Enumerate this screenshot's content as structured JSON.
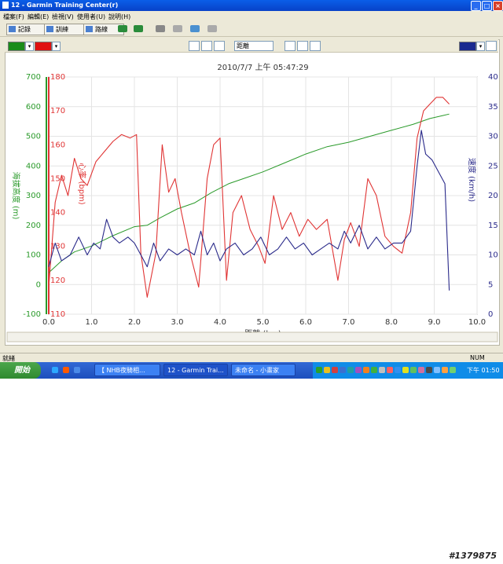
{
  "window": {
    "title": "12 - Garmin Training Center(r)"
  },
  "menu": {
    "items": [
      "檔案(F)",
      "編輯(E)",
      "檢視(V)",
      "使用者(U)",
      "說明(H)"
    ]
  },
  "tabs": [
    "記錄",
    "訓練",
    "路線"
  ],
  "controls": {
    "left_color": "#1a8c1a",
    "right_color": "#e01010",
    "xaxis_select": "距離",
    "right_swatch": "#1a2a90"
  },
  "chart_header": {
    "datetime": "2010/7/7 上午 05:47:29"
  },
  "status": {
    "left": "就緒",
    "right": "NUM"
  },
  "taskbar": {
    "start": "開始",
    "tasks": [
      "【 NHB夜騎相...",
      "12 - Garmin Trai...",
      "未命名 - 小畫家"
    ],
    "clock": "下午 01:50"
  },
  "watermark": "#1379875",
  "colors": {
    "elevation": "#2a9a2a",
    "heart": "#e03434",
    "speed": "#2a2a8a"
  },
  "chart_data": {
    "type": "line",
    "title": "",
    "xlabel": "距離 (km)",
    "xlim": [
      0,
      10
    ],
    "xticks": [
      "0.0",
      "1.0",
      "2.0",
      "3.0",
      "4.0",
      "5.0",
      "6.0",
      "7.0",
      "8.0",
      "9.0",
      "10.0"
    ],
    "axes": {
      "elevation": {
        "label": "海拔高度 (m)",
        "ylim": [
          -100,
          700
        ],
        "ticks": [
          "-100",
          "0",
          "100",
          "200",
          "300",
          "400",
          "500",
          "600",
          "700"
        ]
      },
      "heart_rate": {
        "label": "心率 (bpm)",
        "ylim": [
          110,
          180
        ],
        "ticks": [
          "110",
          "120",
          "130",
          "140",
          "150",
          "160",
          "170",
          "180"
        ]
      },
      "speed": {
        "label": "速度 (km/h)",
        "ylim": [
          0,
          40
        ],
        "ticks": [
          "0",
          "5",
          "10",
          "15",
          "20",
          "25",
          "30",
          "35",
          "40"
        ]
      }
    },
    "series": [
      {
        "name": "海拔高度",
        "axis": "elevation",
        "x": [
          0,
          0.3,
          0.6,
          1.0,
          1.5,
          2.0,
          2.3,
          2.6,
          3.0,
          3.4,
          3.8,
          4.2,
          4.6,
          5.0,
          5.5,
          6.0,
          6.5,
          7.0,
          7.5,
          8.0,
          8.5,
          8.9,
          9.2,
          9.35
        ],
        "y": [
          40,
          80,
          110,
          130,
          165,
          195,
          200,
          225,
          255,
          275,
          310,
          340,
          360,
          380,
          410,
          440,
          465,
          480,
          500,
          520,
          540,
          560,
          570,
          575
        ]
      },
      {
        "name": "心率",
        "axis": "heart_rate",
        "x": [
          0,
          0.15,
          0.3,
          0.45,
          0.6,
          0.75,
          0.9,
          1.1,
          1.3,
          1.5,
          1.7,
          1.9,
          2.05,
          2.15,
          2.3,
          2.5,
          2.65,
          2.8,
          2.95,
          3.1,
          3.3,
          3.5,
          3.7,
          3.85,
          4.0,
          4.15,
          4.3,
          4.5,
          4.7,
          4.9,
          5.05,
          5.25,
          5.45,
          5.65,
          5.85,
          6.05,
          6.25,
          6.5,
          6.75,
          6.9,
          7.05,
          7.25,
          7.45,
          7.65,
          7.85,
          8.05,
          8.25,
          8.45,
          8.6,
          8.75,
          8.9,
          9.05,
          9.2,
          9.35
        ],
        "y": [
          118,
          143,
          151,
          145,
          156,
          150,
          148,
          155,
          158,
          161,
          163,
          162,
          163,
          128,
          115,
          128,
          160,
          146,
          150,
          140,
          128,
          118,
          150,
          160,
          162,
          120,
          140,
          145,
          135,
          130,
          125,
          145,
          135,
          140,
          133,
          138,
          135,
          138,
          120,
          132,
          137,
          130,
          150,
          145,
          133,
          130,
          128,
          140,
          162,
          170,
          172,
          174,
          174,
          172
        ]
      },
      {
        "name": "速度",
        "axis": "speed",
        "x": [
          0,
          0.15,
          0.3,
          0.5,
          0.7,
          0.9,
          1.05,
          1.2,
          1.35,
          1.5,
          1.65,
          1.85,
          2.0,
          2.15,
          2.3,
          2.45,
          2.6,
          2.8,
          3.0,
          3.2,
          3.4,
          3.55,
          3.7,
          3.85,
          4.0,
          4.15,
          4.35,
          4.55,
          4.75,
          4.95,
          5.15,
          5.35,
          5.55,
          5.75,
          5.95,
          6.15,
          6.35,
          6.55,
          6.75,
          6.9,
          7.05,
          7.25,
          7.45,
          7.65,
          7.85,
          8.05,
          8.25,
          8.45,
          8.6,
          8.7,
          8.8,
          8.95,
          9.1,
          9.25,
          9.35
        ],
        "y": [
          8,
          12,
          9,
          10,
          13,
          10,
          12,
          11,
          16,
          13,
          12,
          13,
          12,
          10,
          8,
          12,
          9,
          11,
          10,
          11,
          10,
          14,
          10,
          12,
          9,
          11,
          12,
          10,
          11,
          13,
          10,
          11,
          13,
          11,
          12,
          10,
          11,
          12,
          11,
          14,
          12,
          15,
          11,
          13,
          11,
          12,
          12,
          14,
          25,
          31,
          27,
          26,
          24,
          22,
          4
        ]
      }
    ]
  }
}
